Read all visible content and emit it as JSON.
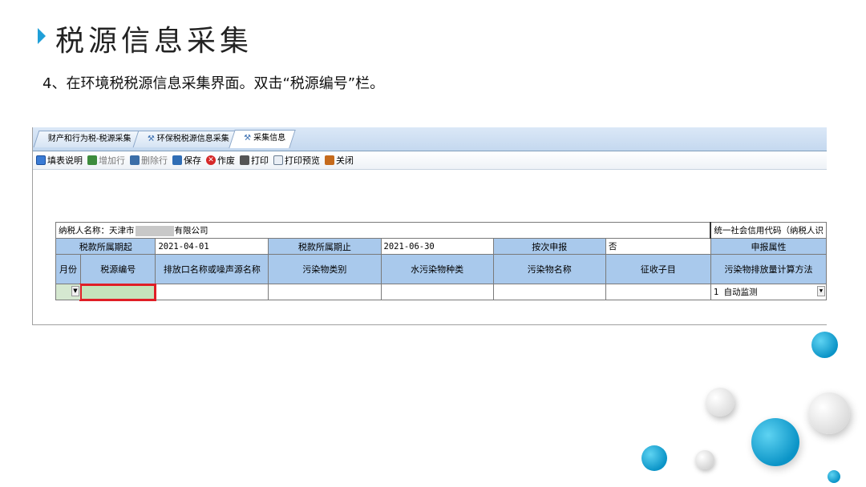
{
  "slide": {
    "title": "税源信息采集",
    "instruction": "4、在环境税税源信息采集界面。双击“税源编号”栏。"
  },
  "tabs": [
    {
      "label": "财产和行为税-税源采集",
      "active": false
    },
    {
      "label": "环保税税源信息采集",
      "active": false
    },
    {
      "label": "采集信息",
      "active": true
    }
  ],
  "toolbar": [
    {
      "label": "填表说明",
      "icon": "help-sheet-icon",
      "enabled": true
    },
    {
      "label": "增加行",
      "icon": "add-row-icon",
      "enabled": false
    },
    {
      "label": "删除行",
      "icon": "delete-row-icon",
      "enabled": false
    },
    {
      "label": "保存",
      "icon": "save-icon",
      "enabled": true
    },
    {
      "label": "作废",
      "icon": "void-icon",
      "enabled": true
    },
    {
      "label": "打印",
      "icon": "printer-icon",
      "enabled": true
    },
    {
      "label": "打印预览",
      "icon": "print-preview-icon",
      "enabled": true
    },
    {
      "label": "关闭",
      "icon": "close-book-icon",
      "enabled": true
    }
  ],
  "form": {
    "taxpayer_label": "纳税人名称：天津市",
    "taxpayer_suffix": "有限公司",
    "credit_code_label": "统一社会信用代码（纳税人识",
    "period_start_label": "税款所属期起",
    "period_start_value": "2021-04-01",
    "period_end_label": "税款所属期止",
    "period_end_value": "2021-06-30",
    "per_filing_label": "按次申报",
    "per_filing_value": "否",
    "filing_attr_label": "申报属性",
    "columns": [
      "月份",
      "税源编号",
      "排放口名称或噪声源名称",
      "污染物类别",
      "水污染物种类",
      "污染物名称",
      "征收子目",
      "污染物排放量计算方法"
    ],
    "row": {
      "month": "",
      "source_no": "",
      "method_value": "1 自动监测"
    }
  },
  "colors": {
    "header_blue": "#a9c9ec",
    "highlight_red": "#e01e26",
    "accent_cyan": "#1f9fd8"
  }
}
